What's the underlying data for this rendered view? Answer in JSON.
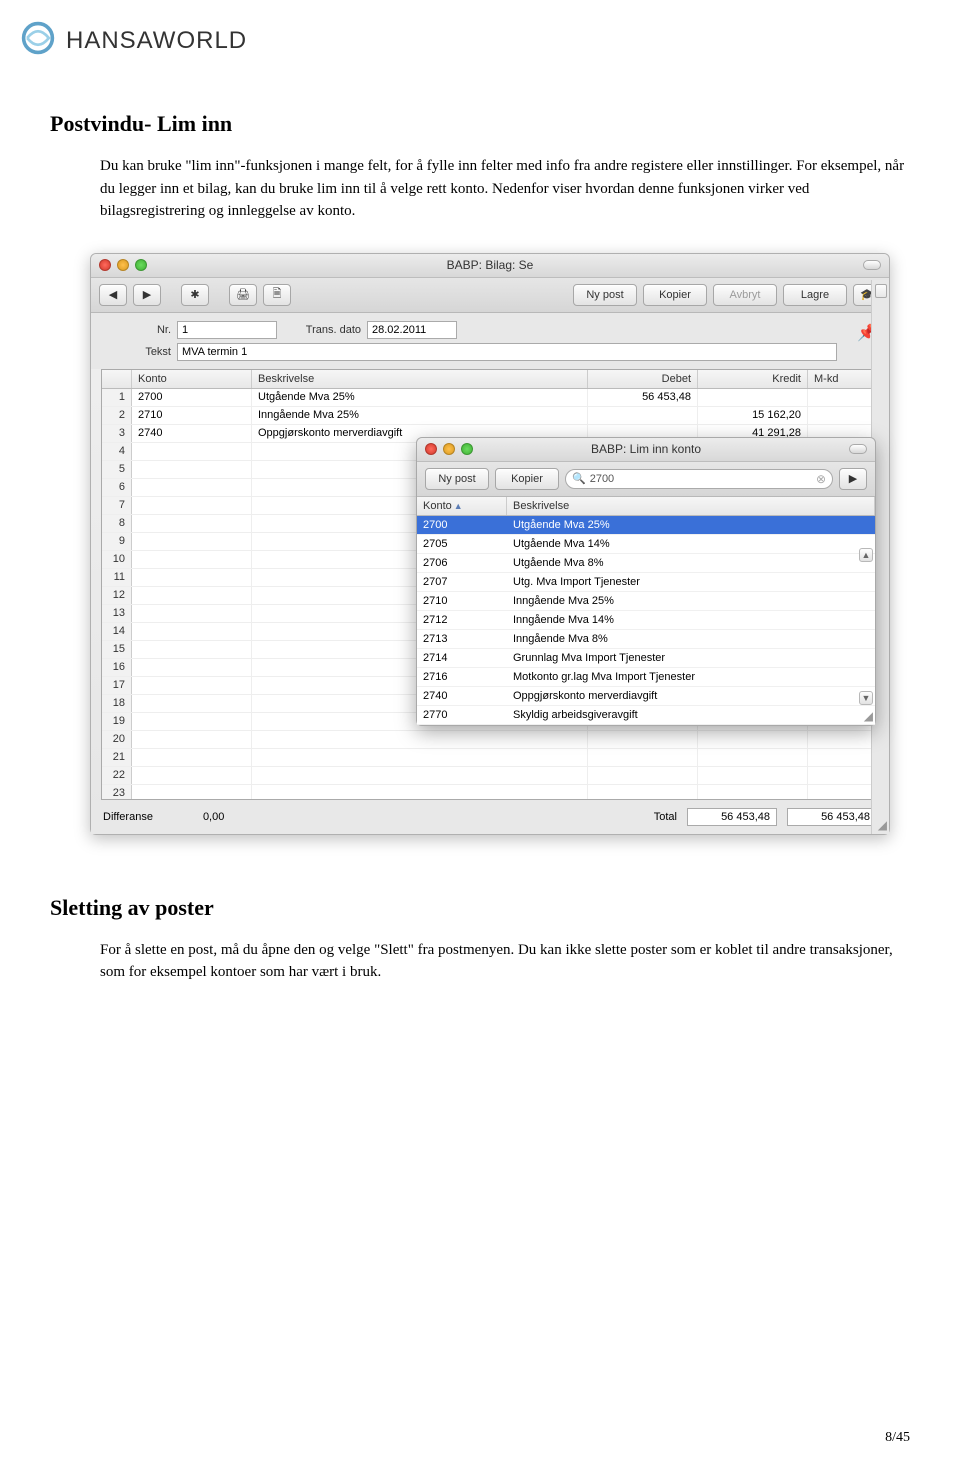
{
  "brand": {
    "name": "HANSAWORLD"
  },
  "section1": {
    "title": "Postvindu- Lim inn",
    "body": "Du kan bruke \"lim inn\"-funksjonen i mange felt, for å fylle inn felter med info fra andre registere eller innstillinger. For eksempel, når du legger inn et bilag, kan du bruke lim inn til å velge rett konto. Nedenfor viser hvordan denne funksjonen virker ved bilagsregistrering og innleggelse av konto."
  },
  "section2": {
    "title": "Sletting av poster",
    "body": "For å slette en post, må du åpne den og velge \"Slett\" fra postmenyen. Du kan ikke slette poster som er koblet til andre transaksjoner, som for eksempel kontoer som har vært i bruk."
  },
  "page_number": "8/45",
  "main_window": {
    "title": "BABP: Bilag: Se",
    "buttons": {
      "ny_post": "Ny post",
      "kopier": "Kopier",
      "avbryt": "Avbryt",
      "lagre": "Lagre"
    },
    "fields": {
      "nr_label": "Nr.",
      "nr_value": "1",
      "dato_label": "Trans. dato",
      "dato_value": "28.02.2011",
      "tekst_label": "Tekst",
      "tekst_value": "MVA termin 1"
    },
    "columns": {
      "konto": "Konto",
      "beskrivelse": "Beskrivelse",
      "debet": "Debet",
      "kredit": "Kredit",
      "mkd": "M-kd"
    },
    "rows": [
      {
        "n": "1",
        "konto": "2700",
        "besk": "Utgående Mva 25%",
        "debet": "56 453,48",
        "kredit": ""
      },
      {
        "n": "2",
        "konto": "2710",
        "besk": "Inngående Mva 25%",
        "debet": "",
        "kredit": "15 162,20"
      },
      {
        "n": "3",
        "konto": "2740",
        "besk": "Oppgjørskonto merverdiavgift",
        "debet": "",
        "kredit": "41 291,28"
      },
      {
        "n": "4"
      },
      {
        "n": "5"
      },
      {
        "n": "6"
      },
      {
        "n": "7"
      },
      {
        "n": "8"
      },
      {
        "n": "9"
      },
      {
        "n": "10"
      },
      {
        "n": "11"
      },
      {
        "n": "12"
      },
      {
        "n": "13"
      },
      {
        "n": "14"
      },
      {
        "n": "15"
      },
      {
        "n": "16"
      },
      {
        "n": "17"
      },
      {
        "n": "18"
      },
      {
        "n": "19"
      },
      {
        "n": "20"
      },
      {
        "n": "21"
      },
      {
        "n": "22"
      },
      {
        "n": "23"
      }
    ],
    "footer": {
      "differanse_label": "Differanse",
      "differanse_value": "0,00",
      "total_label": "Total",
      "total_debet": "56 453,48",
      "total_kredit": "56 453,48"
    }
  },
  "popup": {
    "title": "BABP: Lim inn konto",
    "buttons": {
      "ny_post": "Ny post",
      "kopier": "Kopier"
    },
    "search_value": "2700",
    "columns": {
      "konto": "Konto",
      "beskrivelse": "Beskrivelse"
    },
    "rows": [
      {
        "konto": "2700",
        "besk": "Utgående Mva 25%",
        "selected": true
      },
      {
        "konto": "2705",
        "besk": "Utgående Mva 14%"
      },
      {
        "konto": "2706",
        "besk": "Utgående Mva 8%"
      },
      {
        "konto": "2707",
        "besk": "Utg. Mva Import Tjenester"
      },
      {
        "konto": "2710",
        "besk": "Inngående Mva 25%"
      },
      {
        "konto": "2712",
        "besk": "Inngående Mva 14%"
      },
      {
        "konto": "2713",
        "besk": "Inngående Mva 8%"
      },
      {
        "konto": "2714",
        "besk": "Grunnlag Mva Import Tjenester"
      },
      {
        "konto": "2716",
        "besk": "Motkonto gr.lag Mva Import Tjenester"
      },
      {
        "konto": "2740",
        "besk": "Oppgjørskonto merverdiavgift"
      },
      {
        "konto": "2770",
        "besk": "Skyldig arbeidsgiveravgift"
      }
    ]
  }
}
